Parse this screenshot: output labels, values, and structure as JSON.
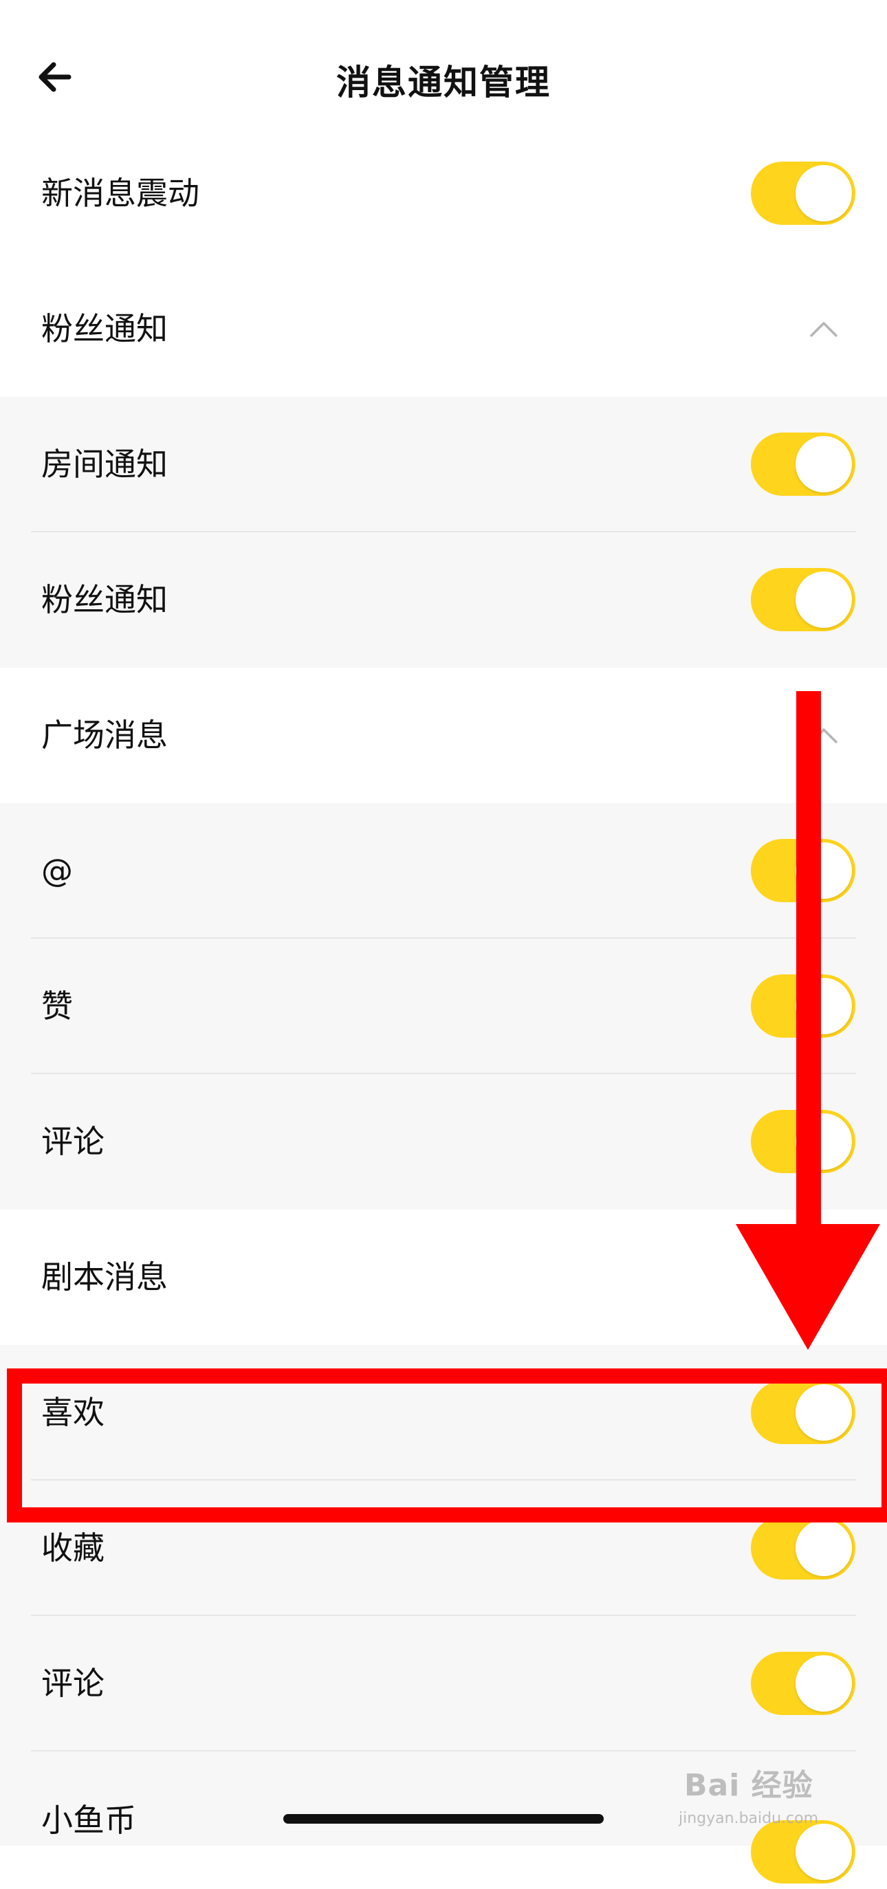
{
  "header": {
    "title": "消息通知管理",
    "back_icon": "arrow-left-icon"
  },
  "colors": {
    "accent_toggle": "#FFD41C",
    "highlight_red": "#FF0000",
    "section_bg": "#F7F7F7"
  },
  "items": {
    "vibrate": {
      "label": "新消息震动",
      "toggle_on": true
    },
    "fans_section": {
      "label": "粉丝通知",
      "expanded": true,
      "icon": "chevron-up-icon"
    },
    "room_notice": {
      "label": "房间通知",
      "toggle_on": true
    },
    "fans_notice": {
      "label": "粉丝通知",
      "toggle_on": true
    },
    "square_section": {
      "label": "广场消息",
      "expanded": true,
      "icon": "chevron-up-icon"
    },
    "mention": {
      "label": "@",
      "toggle_on": true
    },
    "like": {
      "label": "赞",
      "toggle_on": true
    },
    "square_comment": {
      "label": "评论",
      "toggle_on": true
    },
    "script_section": {
      "label": "剧本消息"
    },
    "favorite_like": {
      "label": "喜欢",
      "toggle_on": true
    },
    "collect": {
      "label": "收藏",
      "toggle_on": true
    },
    "script_comment": {
      "label": "评论",
      "toggle_on": true
    },
    "fish_coin": {
      "label": "小鱼币",
      "toggle_on": true
    }
  },
  "annotations": {
    "highlight_target": "喜欢",
    "arrow_direction": "down"
  },
  "watermark": {
    "big": "Bai 经验",
    "small": "jingyan.baidu.com"
  }
}
